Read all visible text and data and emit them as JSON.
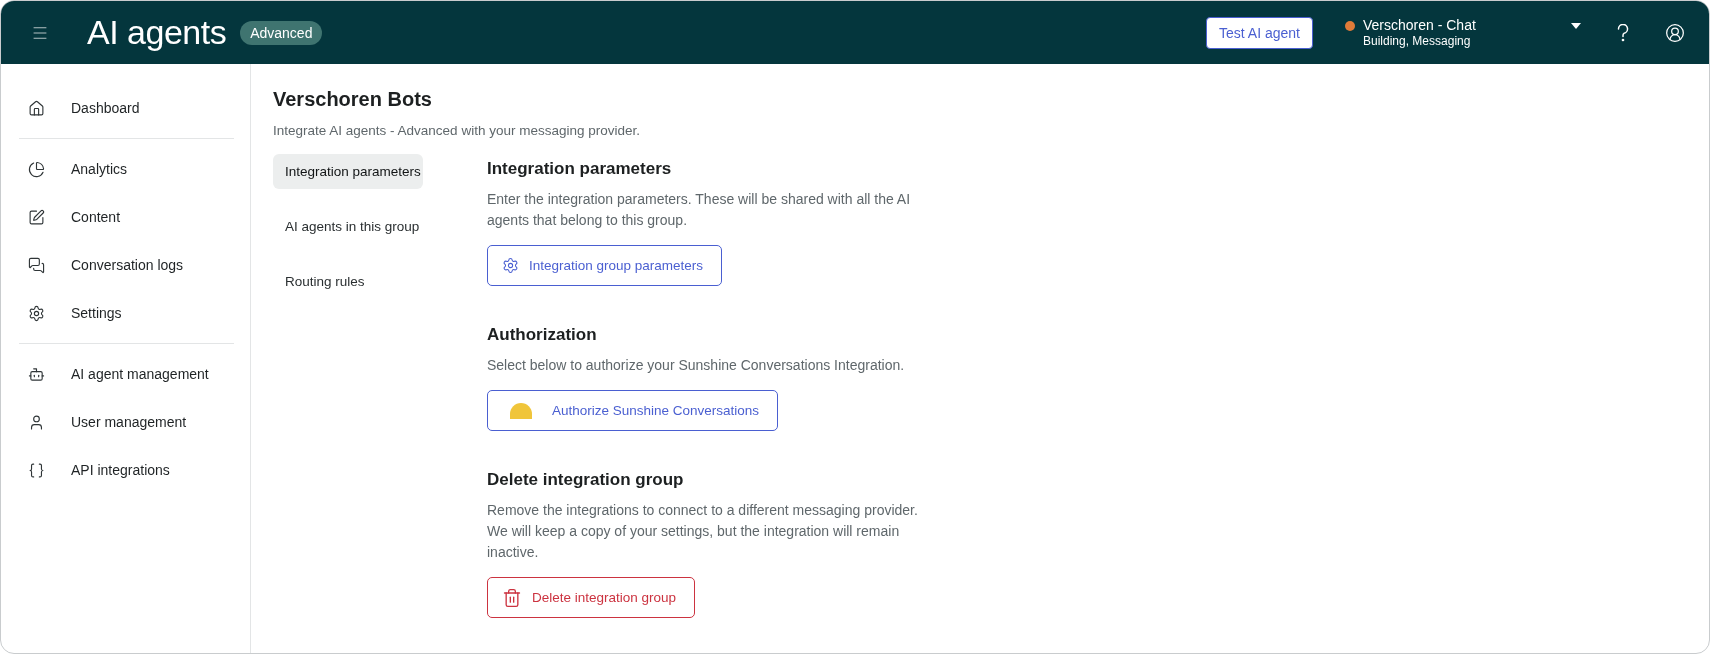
{
  "header": {
    "title": "AI agents",
    "badge": "Advanced",
    "test_button": "Test AI agent",
    "workspace": {
      "name": "Verschoren - Chat",
      "subtitle": "Building, Messaging",
      "color": "#e07b39"
    }
  },
  "sidebar": {
    "groups": [
      {
        "items": [
          {
            "label": "Dashboard",
            "kind": "home"
          }
        ]
      },
      {
        "items": [
          {
            "label": "Analytics",
            "kind": "analytics"
          },
          {
            "label": "Content",
            "kind": "content"
          },
          {
            "label": "Conversation logs",
            "kind": "logs"
          },
          {
            "label": "Settings",
            "kind": "settings"
          }
        ]
      },
      {
        "items": [
          {
            "label": "AI agent management",
            "kind": "bot"
          },
          {
            "label": "User management",
            "kind": "user"
          },
          {
            "label": "API integrations",
            "kind": "api"
          }
        ]
      }
    ]
  },
  "page": {
    "title": "Verschoren Bots",
    "subtitle": "Integrate AI agents - Advanced with your messaging provider."
  },
  "subnav": [
    {
      "label": "Integration parameters",
      "selected": true
    },
    {
      "label": "AI agents in this group",
      "selected": false
    },
    {
      "label": "Routing rules",
      "selected": false
    }
  ],
  "sections": [
    {
      "heading": "Integration parameters",
      "description": "Enter the integration parameters. These will be shared with all the AI agents that belong to this group.",
      "button": {
        "label": "Integration group parameters",
        "kind": "settings"
      }
    },
    {
      "heading": "Authorization",
      "description": "Select below to authorize your Sunshine Conversations Integration.",
      "button": {
        "label": "Authorize Sunshine Conversations",
        "kind": "authorize"
      }
    },
    {
      "heading": "Delete integration group",
      "description": "Remove the integrations to connect to a different messaging provider. We will keep a copy of your settings, but the integration will remain inactive.",
      "button": {
        "label": "Delete integration group",
        "kind": "delete"
      }
    }
  ]
}
